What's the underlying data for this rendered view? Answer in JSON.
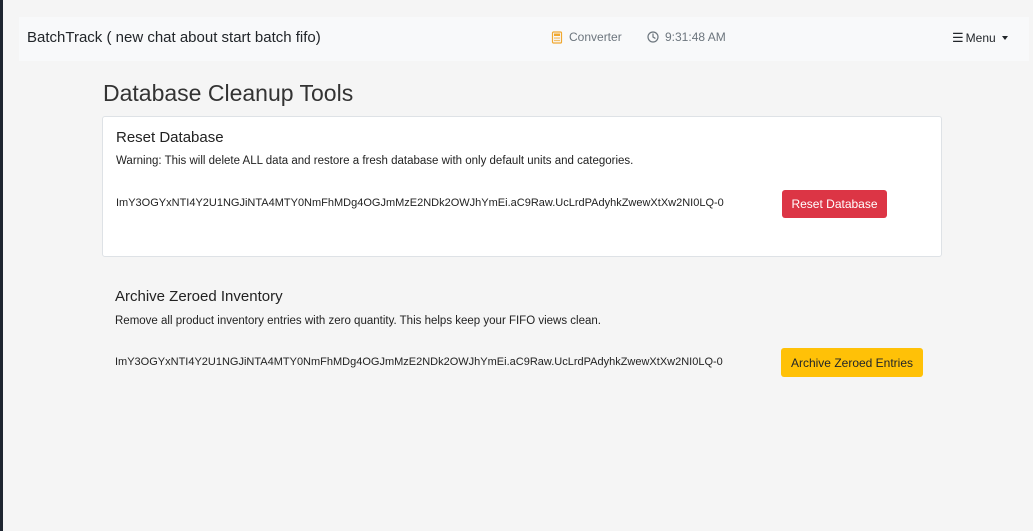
{
  "navbar": {
    "brand": "BatchTrack ( new chat about start batch fifo)",
    "converter_label": "Converter",
    "time": "9:31:48 AM",
    "menu_label": "Menu"
  },
  "page": {
    "title": "Database Cleanup Tools"
  },
  "reset_section": {
    "title": "Reset Database",
    "description": "Warning: This will delete ALL data and restore a fresh database with only default units and categories.",
    "csrf_token": "ImY3OGYxNTI4Y2U1NGJiNTA4MTY0NmFhMDg4OGJmMzE2NDk2OWJhYmEi.aC9Raw.UcLrdPAdyhkZwewXtXw2NI0LQ-0",
    "button_label": "Reset Database",
    "button_color": "#dc3545"
  },
  "archive_section": {
    "title": "Archive Zeroed Inventory",
    "description": "Remove all product inventory entries with zero quantity. This helps keep your FIFO views clean.",
    "csrf_token": "ImY3OGYxNTI4Y2U1NGJiNTA4MTY0NmFhMDg4OGJmMzE2NDk2OWJhYmEi.aC9Raw.UcLrdPAdyhkZwewXtXw2NI0LQ-0",
    "button_label": "Archive Zeroed Entries",
    "button_color": "#ffc107"
  }
}
